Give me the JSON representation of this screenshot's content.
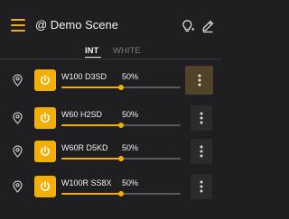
{
  "header": {
    "title": "@ Demo Scene"
  },
  "tabs": {
    "int_label": "INT",
    "white_label": "WHITE"
  },
  "lights": [
    {
      "name": "W100 D3SD",
      "level": "50%",
      "brightness": 0.5
    },
    {
      "name": "W60 H2SD",
      "level": "50%",
      "brightness": 0.5
    },
    {
      "name": "W60R D5KD",
      "level": "50%",
      "brightness": 0.5
    },
    {
      "name": "W100R SS8X",
      "level": "50%",
      "brightness": 0.5
    }
  ],
  "colors": {
    "accent": "#f4b000",
    "background": "#1f1f21",
    "highlight": "#51422a"
  },
  "icons": {
    "menu": "menu-icon",
    "bulb": "lightbulb-add-icon",
    "edit": "pencil-icon",
    "pin": "location-pin-icon",
    "power": "power-icon",
    "more": "more-vertical-icon"
  }
}
